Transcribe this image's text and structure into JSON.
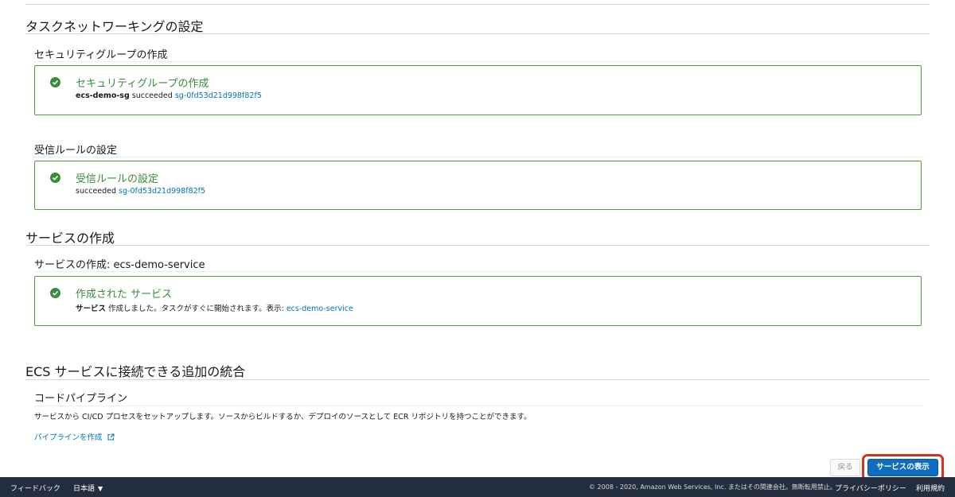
{
  "network": {
    "title": "タスクネットワーキングの設定",
    "sg_section": {
      "subtitle": "セキュリティグループの作成",
      "alert_title": "セキュリティグループの作成",
      "body_bold": "ecs-demo-sg",
      "body_text": " succeeded ",
      "body_link": "sg-0fd53d21d998f82f5"
    },
    "inbound_section": {
      "subtitle": "受信ルールの設定",
      "alert_title": "受信ルールの設定",
      "body_text": "succeeded ",
      "body_link": "sg-0fd53d21d998f82f5"
    }
  },
  "service": {
    "title": "サービスの作成",
    "subtitle": "サービスの作成: ecs-demo-service",
    "alert_title": "作成された サービス",
    "body_bold": "サービス",
    "body_text": " 作成しました。タスクがすぐに開始されます。表示: ",
    "body_link": "ecs-demo-service"
  },
  "integrations": {
    "title": "ECS サービスに接続できる追加の統合",
    "pipeline": {
      "subtitle": "コードパイプライン",
      "description": "サービスから CI/CD プロセスをセットアップします。ソースからビルドするか、デプロイのソースとして ECR リポジトリを持つことができます。",
      "link": "パイプラインを作成"
    }
  },
  "actions": {
    "back_label": "戻る",
    "view_service_label": "サービスの表示"
  },
  "footer": {
    "feedback": "フィードバック",
    "language": "日本語",
    "copyright": "© 2008 - 2020, Amazon Web Services, Inc. またはその関連会社。無断転用禁止。",
    "privacy": "プライバシーポリシー",
    "terms": "利用規約"
  },
  "colors": {
    "success": "#3b8b3b",
    "link": "#0073bb",
    "primary": "#0d6ebf",
    "highlight": "#d5311b",
    "footer_bg": "#232f3e"
  },
  "icons": [
    "check-circle-icon",
    "external-link-icon",
    "caret-down-icon"
  ]
}
